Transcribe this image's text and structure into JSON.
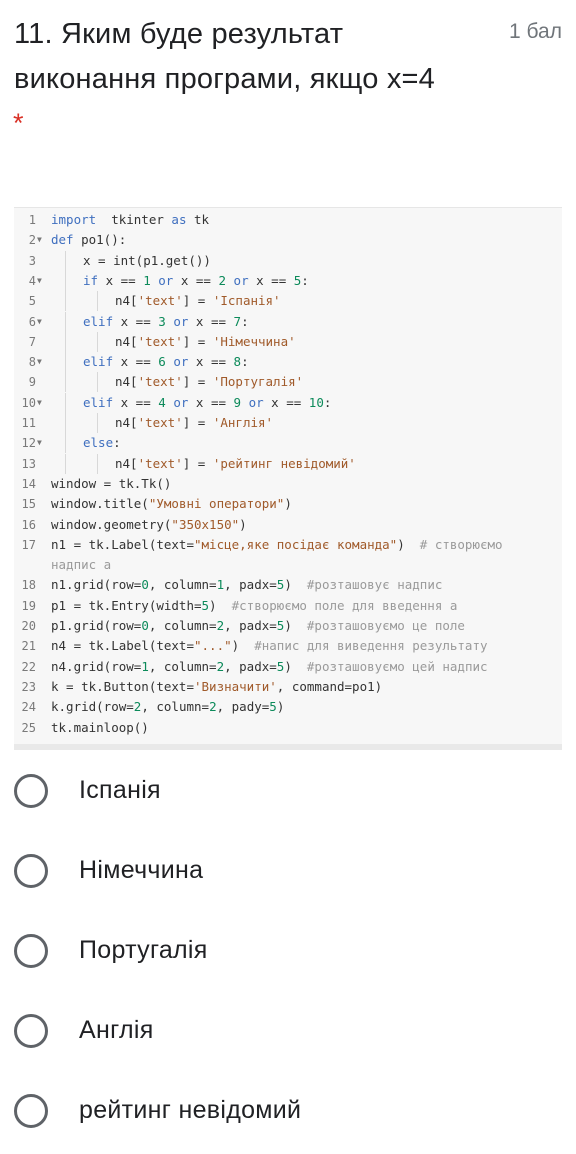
{
  "question": {
    "number_text": "11. Яким буде результат виконання програми, якщо x=4",
    "points": "1 бал",
    "required_mark": "*"
  },
  "code": [
    {
      "n": "1",
      "fold": "",
      "indent": 0,
      "parts": [
        [
          "kw",
          "import"
        ],
        [
          "",
          "  tkinter "
        ],
        [
          "kw",
          "as"
        ],
        [
          "",
          " tk"
        ]
      ]
    },
    {
      "n": "2",
      "fold": "▼",
      "indent": 0,
      "parts": [
        [
          "kw",
          "def"
        ],
        [
          "",
          " po1():"
        ]
      ]
    },
    {
      "n": "3",
      "fold": "",
      "indent": 1,
      "parts": [
        [
          "",
          "x = int(p1.get())"
        ]
      ]
    },
    {
      "n": "4",
      "fold": "▼",
      "indent": 1,
      "parts": [
        [
          "kw",
          "if"
        ],
        [
          "",
          " x == "
        ],
        [
          "num",
          "1"
        ],
        [
          "kw",
          " or"
        ],
        [
          "",
          " x == "
        ],
        [
          "num",
          "2"
        ],
        [
          "kw",
          " or"
        ],
        [
          "",
          " x == "
        ],
        [
          "num",
          "5"
        ],
        [
          "",
          ":"
        ]
      ]
    },
    {
      "n": "5",
      "fold": "",
      "indent": 2,
      "parts": [
        [
          "",
          "n4["
        ],
        [
          "st",
          "'text'"
        ],
        [
          "",
          "] = "
        ],
        [
          "st",
          "'Іспанія'"
        ]
      ]
    },
    {
      "n": "6",
      "fold": "▼",
      "indent": 1,
      "parts": [
        [
          "kw",
          "elif"
        ],
        [
          "",
          " x == "
        ],
        [
          "num",
          "3"
        ],
        [
          "kw",
          " or"
        ],
        [
          "",
          " x == "
        ],
        [
          "num",
          "7"
        ],
        [
          "",
          ":"
        ]
      ]
    },
    {
      "n": "7",
      "fold": "",
      "indent": 2,
      "parts": [
        [
          "",
          "n4["
        ],
        [
          "st",
          "'text'"
        ],
        [
          "",
          "] = "
        ],
        [
          "st",
          "'Німеччина'"
        ]
      ]
    },
    {
      "n": "8",
      "fold": "▼",
      "indent": 1,
      "parts": [
        [
          "kw",
          "elif"
        ],
        [
          "",
          " x == "
        ],
        [
          "num",
          "6"
        ],
        [
          "kw",
          " or"
        ],
        [
          "",
          " x == "
        ],
        [
          "num",
          "8"
        ],
        [
          "",
          ":"
        ]
      ]
    },
    {
      "n": "9",
      "fold": "",
      "indent": 2,
      "parts": [
        [
          "",
          "n4["
        ],
        [
          "st",
          "'text'"
        ],
        [
          "",
          "] = "
        ],
        [
          "st",
          "'Португалія'"
        ]
      ]
    },
    {
      "n": "10",
      "fold": "▼",
      "indent": 1,
      "parts": [
        [
          "kw",
          "elif"
        ],
        [
          "",
          " x == "
        ],
        [
          "num",
          "4"
        ],
        [
          "kw",
          " or"
        ],
        [
          "",
          " x == "
        ],
        [
          "num",
          "9"
        ],
        [
          "kw",
          " or"
        ],
        [
          "",
          " x == "
        ],
        [
          "num",
          "10"
        ],
        [
          "",
          ":"
        ]
      ]
    },
    {
      "n": "11",
      "fold": "",
      "indent": 2,
      "parts": [
        [
          "",
          "n4["
        ],
        [
          "st",
          "'text'"
        ],
        [
          "",
          "] = "
        ],
        [
          "st",
          "'Англія'"
        ]
      ]
    },
    {
      "n": "12",
      "fold": "▼",
      "indent": 1,
      "parts": [
        [
          "kw",
          "else"
        ],
        [
          "",
          ":"
        ]
      ]
    },
    {
      "n": "13",
      "fold": "",
      "indent": 2,
      "parts": [
        [
          "",
          "n4["
        ],
        [
          "st",
          "'text'"
        ],
        [
          "",
          "] = "
        ],
        [
          "st",
          "'рейтинг невідомий'"
        ]
      ]
    },
    {
      "n": "14",
      "fold": "",
      "indent": 0,
      "parts": [
        [
          "",
          "window = tk.Tk()"
        ]
      ]
    },
    {
      "n": "15",
      "fold": "",
      "indent": 0,
      "parts": [
        [
          "",
          "window.title("
        ],
        [
          "st",
          "\"Умовні оператори\""
        ],
        [
          "",
          ")"
        ]
      ]
    },
    {
      "n": "16",
      "fold": "",
      "indent": 0,
      "parts": [
        [
          "",
          "window.geometry("
        ],
        [
          "st",
          "\"350x150\""
        ],
        [
          "",
          ")"
        ]
      ]
    },
    {
      "n": "17",
      "fold": "",
      "indent": 0,
      "parts": [
        [
          "",
          "n1 = tk.Label(text="
        ],
        [
          "st",
          "\"місце,яке посідає команда\""
        ],
        [
          "",
          ")  "
        ],
        [
          "cm",
          "# створюємо"
        ]
      ]
    },
    {
      "n": "",
      "fold": "",
      "indent": 0,
      "parts": [
        [
          "cm",
          "надпис а"
        ]
      ]
    },
    {
      "n": "18",
      "fold": "",
      "indent": 0,
      "parts": [
        [
          "",
          "n1.grid(row="
        ],
        [
          "num",
          "0"
        ],
        [
          "",
          ", column="
        ],
        [
          "num",
          "1"
        ],
        [
          "",
          ", padx="
        ],
        [
          "num",
          "5"
        ],
        [
          "",
          ")  "
        ],
        [
          "cm",
          "#розташовує надпис"
        ]
      ]
    },
    {
      "n": "19",
      "fold": "",
      "indent": 0,
      "parts": [
        [
          "",
          "p1 = tk.Entry(width="
        ],
        [
          "num",
          "5"
        ],
        [
          "",
          ")  "
        ],
        [
          "cm",
          "#створюємо поле для введення а"
        ]
      ]
    },
    {
      "n": "20",
      "fold": "",
      "indent": 0,
      "parts": [
        [
          "",
          "p1.grid(row="
        ],
        [
          "num",
          "0"
        ],
        [
          "",
          ", column="
        ],
        [
          "num",
          "2"
        ],
        [
          "",
          ", padx="
        ],
        [
          "num",
          "5"
        ],
        [
          "",
          ")  "
        ],
        [
          "cm",
          "#розташовуємо це поле"
        ]
      ]
    },
    {
      "n": "21",
      "fold": "",
      "indent": 0,
      "parts": [
        [
          "",
          "n4 = tk.Label(text="
        ],
        [
          "st",
          "\"...\""
        ],
        [
          "",
          ")  "
        ],
        [
          "cm",
          "#напис для виведення результату"
        ]
      ]
    },
    {
      "n": "22",
      "fold": "",
      "indent": 0,
      "parts": [
        [
          "",
          "n4.grid(row="
        ],
        [
          "num",
          "1"
        ],
        [
          "",
          ", column="
        ],
        [
          "num",
          "2"
        ],
        [
          "",
          ", padx="
        ],
        [
          "num",
          "5"
        ],
        [
          "",
          ")  "
        ],
        [
          "cm",
          "#розташовуємо цей надпис"
        ]
      ]
    },
    {
      "n": "23",
      "fold": "",
      "indent": 0,
      "parts": [
        [
          "",
          "k = tk.Button(text="
        ],
        [
          "st",
          "'Визначити'"
        ],
        [
          "",
          ", command=po1)"
        ]
      ]
    },
    {
      "n": "24",
      "fold": "",
      "indent": 0,
      "parts": [
        [
          "",
          "k.grid(row="
        ],
        [
          "num",
          "2"
        ],
        [
          "",
          ", column="
        ],
        [
          "num",
          "2"
        ],
        [
          "",
          ", pady="
        ],
        [
          "num",
          "5"
        ],
        [
          "",
          ")"
        ]
      ]
    },
    {
      "n": "25",
      "fold": "",
      "indent": 0,
      "parts": [
        [
          "",
          "tk.mainloop()"
        ]
      ]
    }
  ],
  "options": [
    {
      "label": "Іспанія"
    },
    {
      "label": "Німеччина"
    },
    {
      "label": "Португалія"
    },
    {
      "label": "Англія"
    },
    {
      "label": "рейтинг невідомий"
    }
  ]
}
